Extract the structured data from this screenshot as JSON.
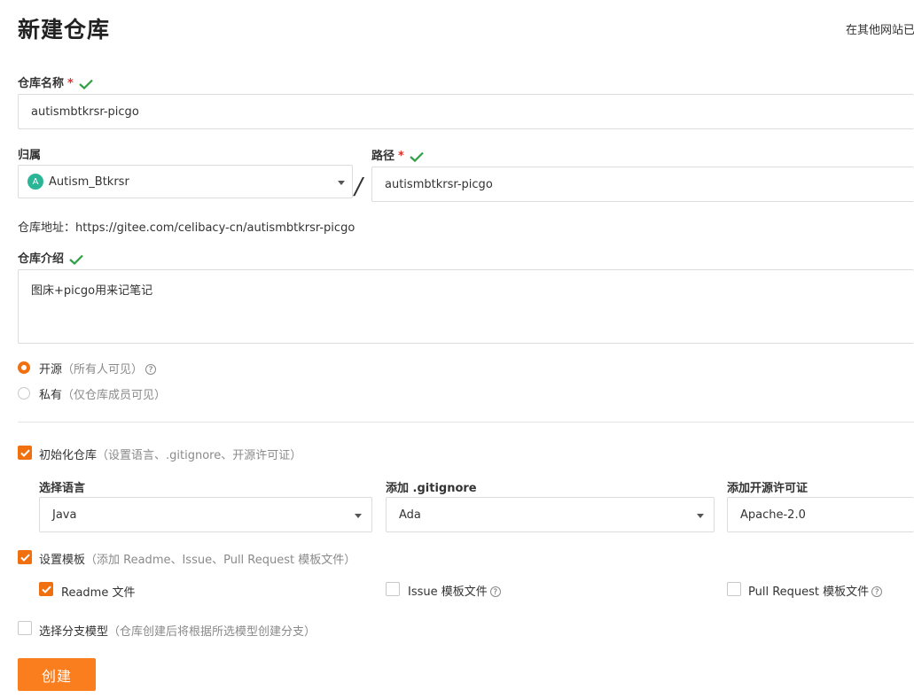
{
  "page": {
    "title": "新建仓库",
    "import_link": "在其他网站已"
  },
  "repo_name": {
    "label": "仓库名称",
    "required_mark": "*",
    "value": "autismbtkrsr-picgo"
  },
  "owner": {
    "label": "归属",
    "avatar_letter": "A",
    "value": "Autism_Btkrsr"
  },
  "separator": "/",
  "path": {
    "label": "路径",
    "required_mark": "*",
    "value": "autismbtkrsr-picgo"
  },
  "repo_address": {
    "label": "仓库地址：",
    "url": "https://gitee.com/celibacy-cn/autismbtkrsr-picgo"
  },
  "description": {
    "label": "仓库介绍",
    "value": "图床+picgo用来记笔记"
  },
  "visibility": {
    "options": [
      {
        "label": "开源",
        "note": "（所有人可见）",
        "selected": true,
        "help": "?"
      },
      {
        "label": "私有",
        "note": "（仅仓库成员可见）",
        "selected": false
      }
    ]
  },
  "init_repo": {
    "label": "初始化仓库",
    "note": "（设置语言、.gitignore、开源许可证）",
    "checked": true,
    "language": {
      "label": "选择语言",
      "value": "Java"
    },
    "gitignore": {
      "label": "添加 .gitignore",
      "value": "Ada"
    },
    "license": {
      "label": "添加开源许可证",
      "value": "Apache-2.0"
    }
  },
  "templates": {
    "label": "设置模板",
    "note": "（添加 Readme、Issue、Pull Request 模板文件）",
    "checked": true,
    "readme": {
      "label": "Readme 文件",
      "checked": true
    },
    "issue": {
      "label": "Issue 模板文件",
      "checked": false,
      "help": "?"
    },
    "pull_request": {
      "label": "Pull Request 模板文件",
      "checked": false,
      "help": "?"
    }
  },
  "branch_model": {
    "label": "选择分支模型",
    "note": "（仓库创建后将根据所选模型创建分支）",
    "checked": false
  },
  "create_button": "创建",
  "colors": {
    "accent": "#f0700f",
    "button": "#fa7d1e",
    "valid": "#2ea043",
    "required": "#e0312a"
  }
}
